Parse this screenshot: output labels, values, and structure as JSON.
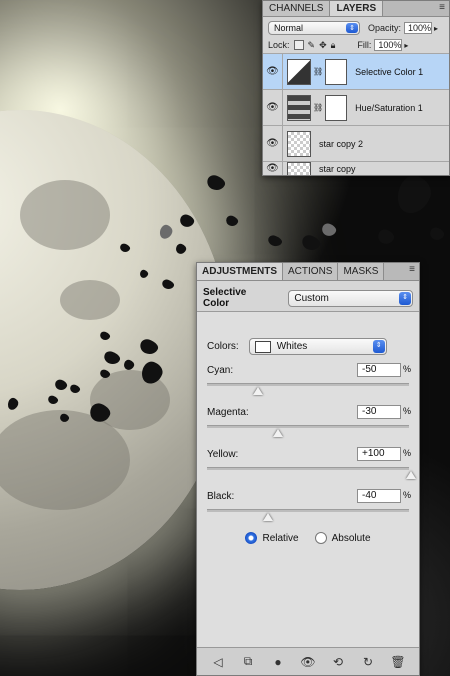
{
  "layers_panel": {
    "tabs": [
      "CHANNELS",
      "LAYERS"
    ],
    "active_tab": "LAYERS",
    "blend_mode": "Normal",
    "opacity_label": "Opacity:",
    "opacity_value": "100%",
    "lock_label": "Lock:",
    "fill_label": "Fill:",
    "fill_value": "100%",
    "layers": [
      {
        "name": "Selective Color 1",
        "selected": true,
        "thumb": "adjustment"
      },
      {
        "name": "Hue/Saturation 1",
        "selected": false,
        "thumb": "hue-sat"
      },
      {
        "name": "star copy 2",
        "selected": false,
        "thumb": "transparent"
      },
      {
        "name": "star copy",
        "selected": false,
        "thumb": "transparent"
      }
    ]
  },
  "adjustments_panel": {
    "tabs": [
      "ADJUSTMENTS",
      "ACTIONS",
      "MASKS"
    ],
    "active_tab": "ADJUSTMENTS",
    "title": "Selective Color",
    "preset": "Custom",
    "colors_label": "Colors:",
    "colors_value": "Whites",
    "sliders": [
      {
        "label": "Cyan:",
        "value": "-50",
        "fraction": 0.25
      },
      {
        "label": "Magenta:",
        "value": "-30",
        "fraction": 0.35
      },
      {
        "label": "Yellow:",
        "value": "+100",
        "fraction": 1.0
      },
      {
        "label": "Black:",
        "value": "-40",
        "fraction": 0.3
      }
    ],
    "percent_symbol": "%",
    "method_relative": "Relative",
    "method_absolute": "Absolute",
    "method_selected": "Relative",
    "footer_icons": [
      "back-arrow-icon",
      "expand-view-icon",
      "clip-layer-icon",
      "visibility-eye-icon",
      "view-previous-icon",
      "reset-icon",
      "trash-icon"
    ]
  }
}
